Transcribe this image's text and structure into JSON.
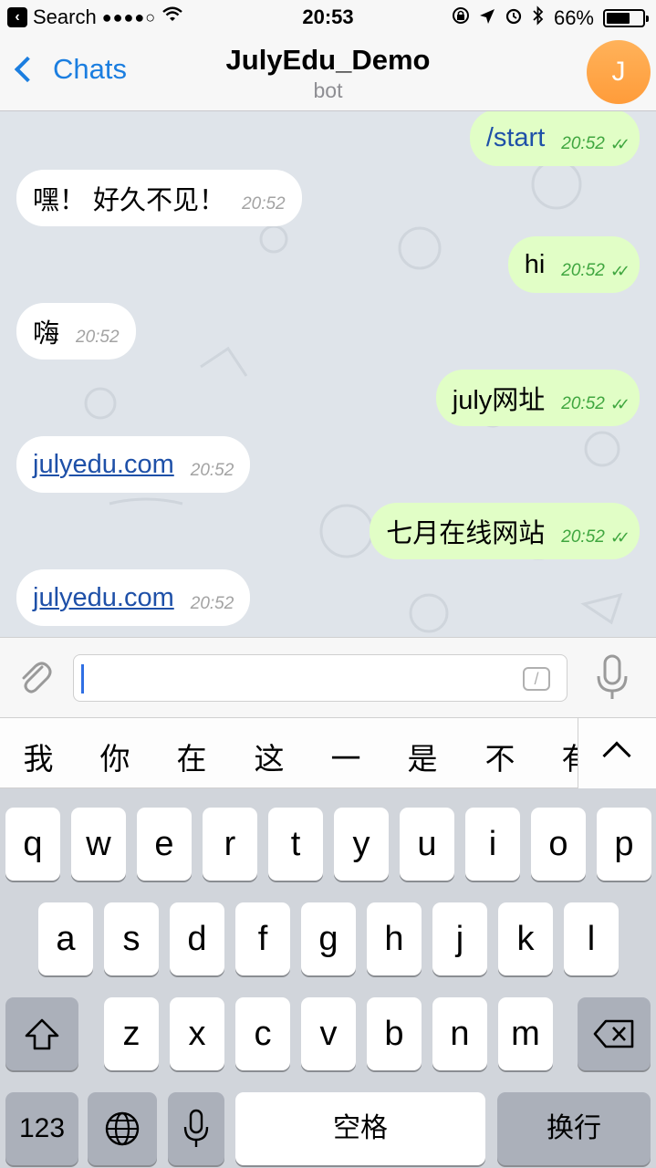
{
  "status_bar": {
    "back_app_label": "Search",
    "signal": "●●●●○",
    "time": "20:53",
    "battery_text": "66%",
    "battery_level": 0.66
  },
  "nav": {
    "back_label": "Chats",
    "title": "JulyEdu_Demo",
    "subtitle": "bot",
    "avatar_letter": "J"
  },
  "messages": [
    {
      "dir": "out",
      "text": "/start",
      "time": "20:52"
    },
    {
      "dir": "in",
      "text": "嘿！ 好久不见！",
      "time": "20:52"
    },
    {
      "dir": "out",
      "text": "hi",
      "time": "20:52"
    },
    {
      "dir": "in",
      "text": "嗨",
      "time": "20:52"
    },
    {
      "dir": "out",
      "text": "july网址",
      "time": "20:52"
    },
    {
      "dir": "in",
      "text": "julyedu.com",
      "time": "20:52"
    },
    {
      "dir": "out",
      "text": "七月在线网站",
      "time": "20:52"
    },
    {
      "dir": "in",
      "text": "julyedu.com",
      "time": "20:52"
    }
  ],
  "input": {
    "value": "",
    "command_button": "/"
  },
  "suggestions": [
    "我",
    "你",
    "在",
    "这",
    "一",
    "是",
    "不",
    "有"
  ],
  "keyboard": {
    "row1": [
      "q",
      "w",
      "e",
      "r",
      "t",
      "y",
      "u",
      "i",
      "o",
      "p"
    ],
    "row2": [
      "a",
      "s",
      "d",
      "f",
      "g",
      "h",
      "j",
      "k",
      "l"
    ],
    "row3": [
      "z",
      "x",
      "c",
      "v",
      "b",
      "n",
      "m"
    ],
    "numbers_key": "123",
    "space_key": "空格",
    "return_key": "换行"
  },
  "colors": {
    "accent": "#1b7ee0",
    "outgoing_bubble": "#e1fec6",
    "incoming_bubble": "#ffffff",
    "link": "#1e50a8",
    "read_ticks": "#3fa63f"
  }
}
